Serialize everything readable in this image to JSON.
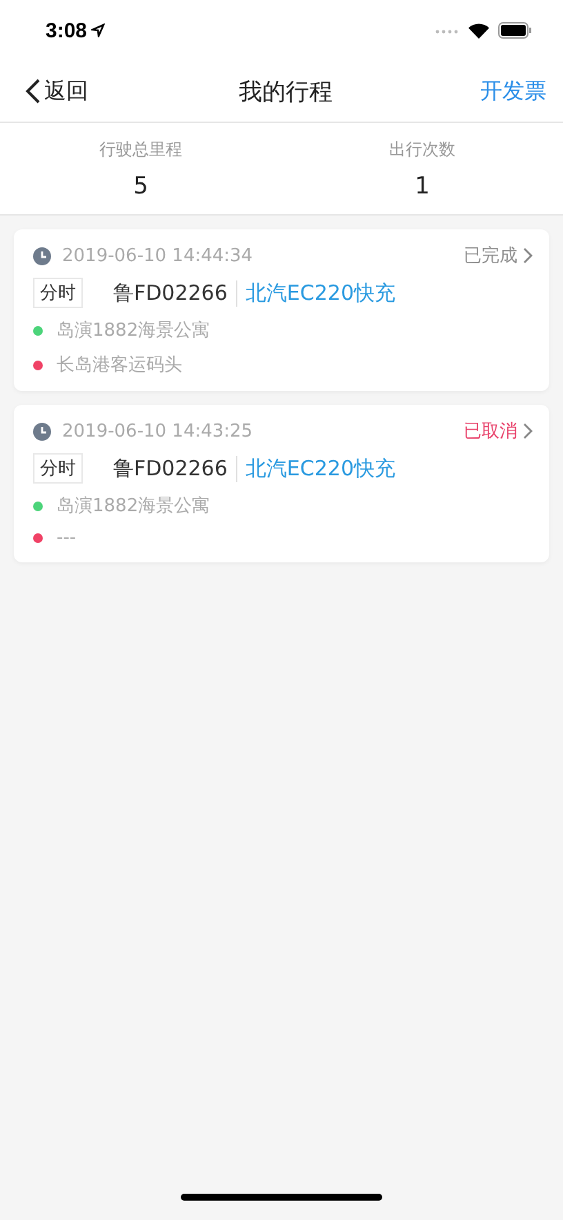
{
  "status_bar": {
    "time": "3:08"
  },
  "nav": {
    "back": "返回",
    "title": "我的行程",
    "action": "开发票"
  },
  "stats": [
    {
      "label": "行驶总里程",
      "value": "5"
    },
    {
      "label": "出行次数",
      "value": "1"
    }
  ],
  "trips": [
    {
      "time": "2019-06-10 14:44:34",
      "status": "已完成",
      "color": "#8e8e8e",
      "tag": "分时",
      "plate": "鲁FD02266",
      "model": "北汽EC220快充",
      "start": "岛演1882海景公寓",
      "end": "长岛港客运码头"
    },
    {
      "time": "2019-06-10 14:43:25",
      "status": "已取消",
      "color": "#e8416a",
      "tag": "分时",
      "plate": "鲁FD02266",
      "model": "北汽EC220快充",
      "start": "岛演1882海景公寓",
      "end": "---"
    }
  ]
}
